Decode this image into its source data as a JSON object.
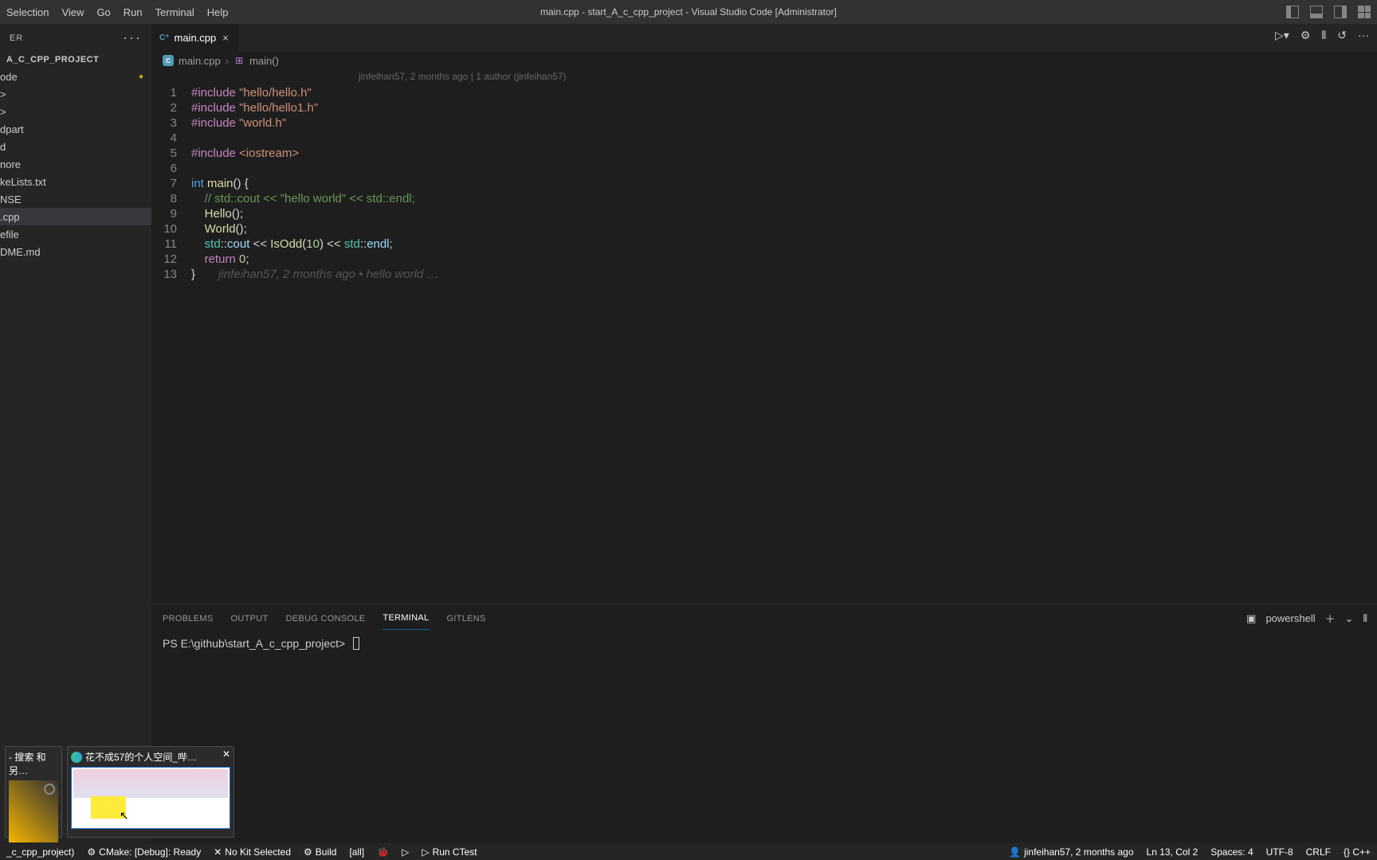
{
  "menu": [
    "Selection",
    "View",
    "Go",
    "Run",
    "Terminal",
    "Help"
  ],
  "window_title": "main.cpp - start_A_c_cpp_project - Visual Studio Code [Administrator]",
  "sidebar": {
    "header_label": "ER",
    "project": "A_C_CPP_PROJECT",
    "items": [
      {
        "label": "ode",
        "modified": true
      },
      {
        "label": ">"
      },
      {
        "label": ">"
      },
      {
        "label": "dpart"
      },
      {
        "label": "d"
      },
      {
        "label": "nore"
      },
      {
        "label": "keLists.txt"
      },
      {
        "label": "NSE"
      },
      {
        "label": ".cpp",
        "selected": true
      },
      {
        "label": "efile"
      },
      {
        "label": "DME.md"
      }
    ]
  },
  "tab": {
    "label": "main.cpp"
  },
  "breadcrumb": {
    "file": "main.cpp",
    "symbol": "main()"
  },
  "blame_header": "jinfeihan57, 2 months ago | 1 author (jinfeihan57)",
  "code_lines": [
    {
      "n": 1,
      "tokens": [
        [
          "tok-include",
          "#include"
        ],
        [
          "tok-default",
          " "
        ],
        [
          "tok-string",
          "\"hello/hello.h\""
        ]
      ]
    },
    {
      "n": 2,
      "tokens": [
        [
          "tok-include",
          "#include"
        ],
        [
          "tok-default",
          " "
        ],
        [
          "tok-string",
          "\"hello/hello1.h\""
        ]
      ]
    },
    {
      "n": 3,
      "tokens": [
        [
          "tok-include",
          "#include"
        ],
        [
          "tok-default",
          " "
        ],
        [
          "tok-string",
          "\"world.h\""
        ]
      ]
    },
    {
      "n": 4,
      "tokens": []
    },
    {
      "n": 5,
      "tokens": [
        [
          "tok-include",
          "#include"
        ],
        [
          "tok-default",
          " "
        ],
        [
          "tok-string",
          "<iostream>"
        ]
      ]
    },
    {
      "n": 6,
      "tokens": []
    },
    {
      "n": 7,
      "tokens": [
        [
          "tok-keyword",
          "int"
        ],
        [
          "tok-default",
          " "
        ],
        [
          "tok-func",
          "main"
        ],
        [
          "tok-default",
          "() {"
        ]
      ]
    },
    {
      "n": 8,
      "tokens": [
        [
          "tok-default",
          "    "
        ],
        [
          "tok-comment",
          "// std::cout << \"hello world\" << std::endl;"
        ]
      ]
    },
    {
      "n": 9,
      "tokens": [
        [
          "tok-default",
          "    "
        ],
        [
          "tok-func",
          "Hello"
        ],
        [
          "tok-default",
          "();"
        ]
      ]
    },
    {
      "n": 10,
      "tokens": [
        [
          "tok-default",
          "    "
        ],
        [
          "tok-func",
          "World"
        ],
        [
          "tok-default",
          "();"
        ]
      ]
    },
    {
      "n": 11,
      "tokens": [
        [
          "tok-default",
          "    "
        ],
        [
          "tok-type",
          "std"
        ],
        [
          "tok-default",
          "::"
        ],
        [
          "tok-var",
          "cout"
        ],
        [
          "tok-default",
          " << "
        ],
        [
          "tok-func",
          "IsOdd"
        ],
        [
          "tok-default",
          "("
        ],
        [
          "tok-number",
          "10"
        ],
        [
          "tok-default",
          ") << "
        ],
        [
          "tok-type",
          "std"
        ],
        [
          "tok-default",
          "::"
        ],
        [
          "tok-var",
          "endl"
        ],
        [
          "tok-default",
          ";"
        ]
      ]
    },
    {
      "n": 12,
      "tokens": [
        [
          "tok-default",
          "    "
        ],
        [
          "tok-include",
          "return"
        ],
        [
          "tok-default",
          " "
        ],
        [
          "tok-number",
          "0"
        ],
        [
          "tok-default",
          ";"
        ]
      ]
    },
    {
      "n": 13,
      "tokens": [
        [
          "tok-default",
          "}       "
        ],
        [
          "tok-blame",
          "jinfeihan57, 2 months ago • hello world …"
        ]
      ]
    }
  ],
  "panel": {
    "tabs": [
      "PROBLEMS",
      "OUTPUT",
      "DEBUG CONSOLE",
      "TERMINAL",
      "GITLENS"
    ],
    "active": "TERMINAL",
    "shell": "powershell",
    "prompt": "PS E:\\github\\start_A_c_cpp_project>"
  },
  "status": {
    "left": [
      "_c_cpp_project)",
      "CMake: [Debug]: Ready",
      "No Kit Selected",
      "Build",
      "[all]",
      "Run CTest"
    ],
    "right": [
      "jinfeihan57, 2 months ago",
      "Ln 13, Col 2",
      "Spaces: 4",
      "UTF-8",
      "CRLF",
      "{} C++"
    ]
  },
  "taskbar": {
    "card1": "- 搜索 和另…",
    "card2": "花不成57的个人空间_哔…"
  }
}
